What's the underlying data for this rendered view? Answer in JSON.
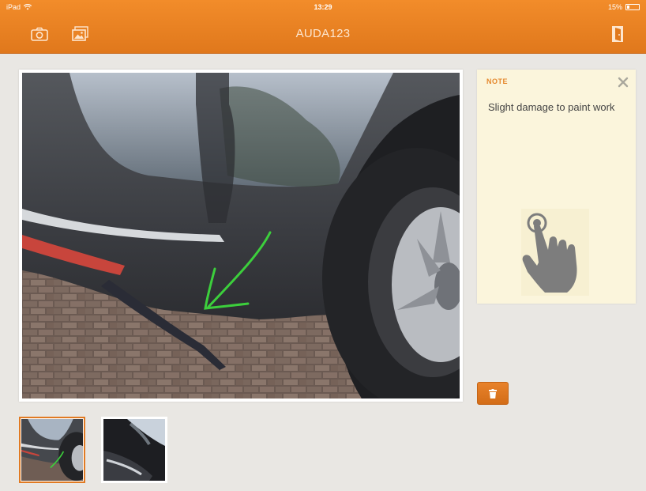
{
  "status_bar": {
    "device": "iPad",
    "time": "13:29",
    "battery": "15%"
  },
  "toolbar": {
    "title": "AUDA123",
    "icons": [
      "camera-icon",
      "gallery-icon",
      "exit-door-icon"
    ]
  },
  "note": {
    "label": "NOTE",
    "text": "Slight damage to paint work",
    "icons": [
      "close-icon",
      "tap-gesture-icon"
    ]
  },
  "actions": {
    "delete_icon": "trash-icon"
  },
  "thumbnails": {
    "count": 2,
    "selected_index": 0
  },
  "colors": {
    "header": "#f28c2a",
    "accent": "#e17a22",
    "note_bg": "#fbf5dc",
    "annotation": "#3ccf3c"
  }
}
